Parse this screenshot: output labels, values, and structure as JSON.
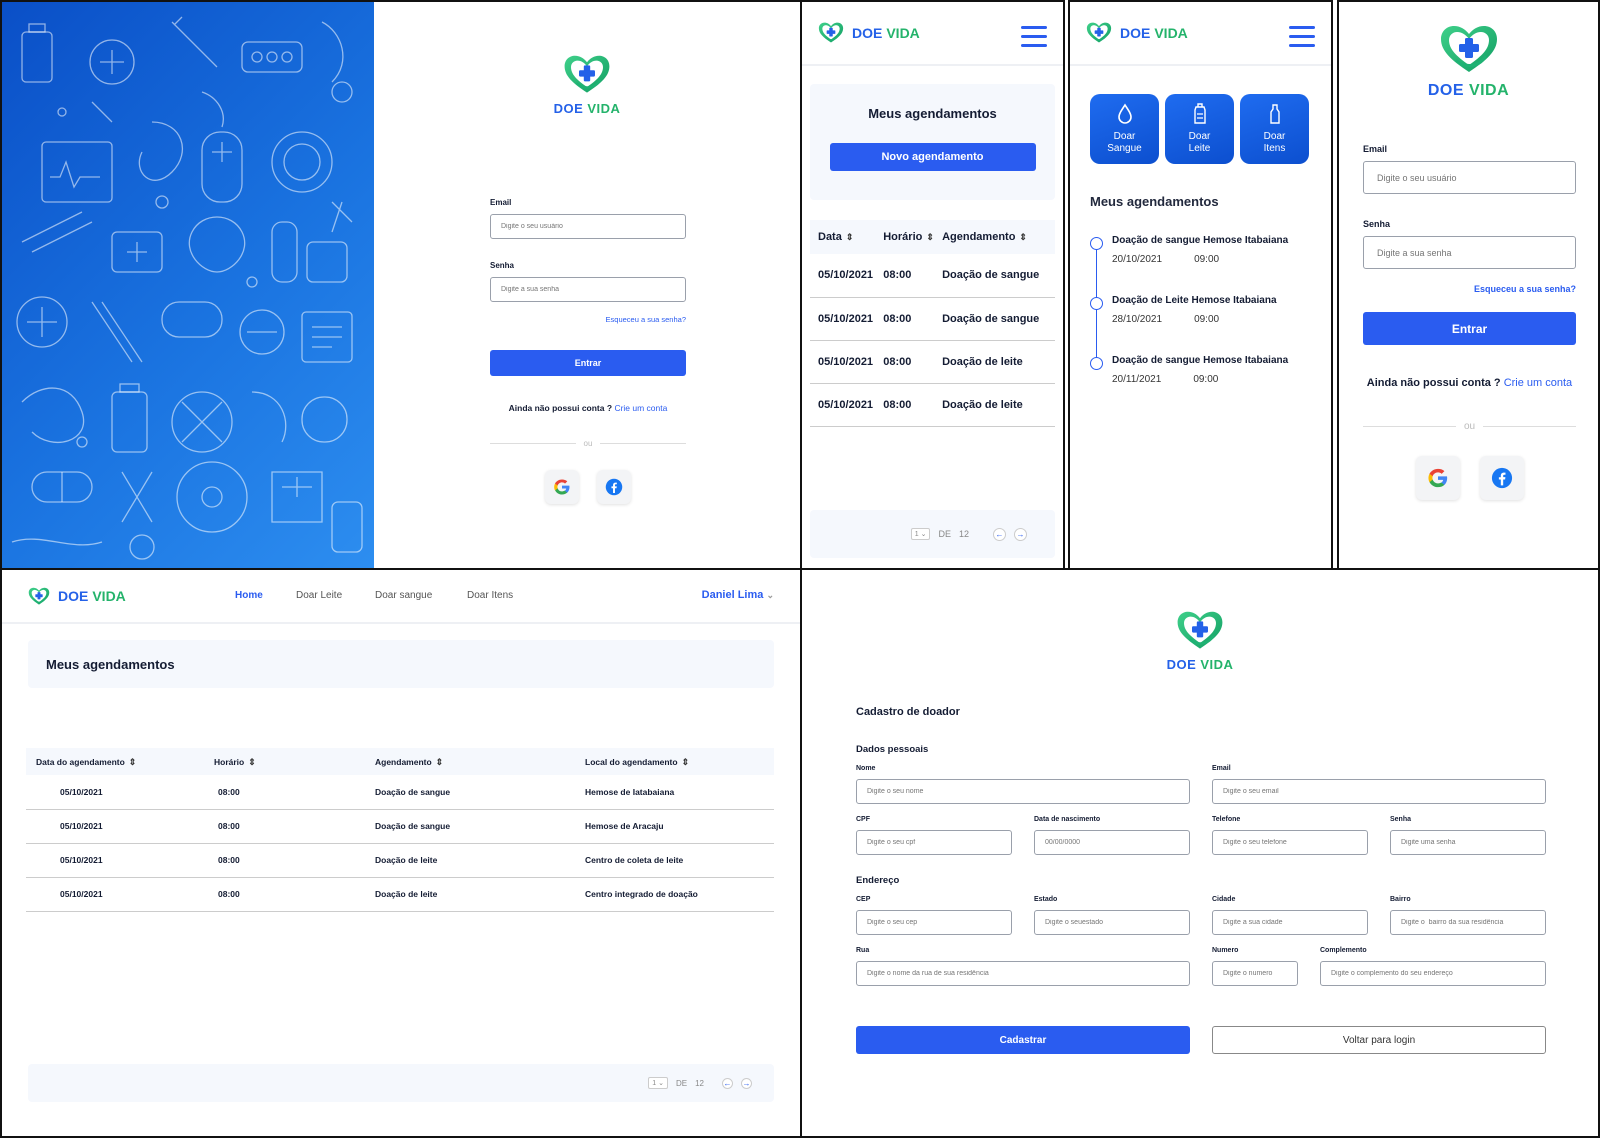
{
  "brand": {
    "doe": "DOE",
    "vida": "VIDA"
  },
  "colors": {
    "primary": "#2a5cf0",
    "brand_green": "#24b36b",
    "brand_blue": "#2461e8"
  },
  "login": {
    "email_label": "Email",
    "email_placeholder": "Digite o seu usuário",
    "password_label": "Senha",
    "password_placeholder": "Digite a sua senha",
    "forgot": "Esqueceu a sua senha?",
    "submit": "Entrar",
    "no_account": "Ainda não possui conta ?",
    "create": "Crie um conta",
    "or": "ou",
    "social": [
      "google-icon",
      "facebook-icon"
    ]
  },
  "mobile_list": {
    "title": "Meus agendamentos",
    "new_button": "Novo agendamento",
    "columns": [
      "Data",
      "Horário",
      "Agendamento"
    ],
    "rows": [
      {
        "date": "05/10/2021",
        "time": "08:00",
        "type": "Doação de sangue"
      },
      {
        "date": "05/10/2021",
        "time": "08:00",
        "type": "Doação de sangue"
      },
      {
        "date": "05/10/2021",
        "time": "08:00",
        "type": "Doação de leite"
      },
      {
        "date": "05/10/2021",
        "time": "08:00",
        "type": "Doação de leite"
      }
    ],
    "pager": {
      "page": "1",
      "of": "DE",
      "total": "12"
    }
  },
  "mobile_home": {
    "tiles": [
      {
        "line1": "Doar",
        "line2": "Sangue",
        "icon": "drop-icon"
      },
      {
        "line1": "Doar",
        "line2": "Leite",
        "icon": "baby-bottle-icon"
      },
      {
        "line1": "Doar",
        "line2": "Itens",
        "icon": "bottle-icon"
      }
    ],
    "section_title": "Meus agendamentos",
    "timeline": [
      {
        "title": "Doação de sangue Hemose Itabaiana",
        "date": "20/10/2021",
        "time": "09:00"
      },
      {
        "title": "Doação de Leite Hemose Itabaiana",
        "date": "28/10/2021",
        "time": "09:00"
      },
      {
        "title": "Doação de sangue Hemose Itabaiana",
        "date": "20/11/2021",
        "time": "09:00"
      }
    ]
  },
  "desktop": {
    "nav": [
      "Home",
      "Doar Leite",
      "Doar sangue",
      "Doar Itens"
    ],
    "user": "Daniel Lima",
    "title": "Meus agendamentos",
    "columns": [
      "Data do agendamento",
      "Horário",
      "Agendamento",
      "Local do agendamento"
    ],
    "rows": [
      {
        "date": "05/10/2021",
        "time": "08:00",
        "type": "Doação de sangue",
        "place": "Hemose de Iatabaiana"
      },
      {
        "date": "05/10/2021",
        "time": "08:00",
        "type": "Doação de sangue",
        "place": "Hemose de Aracaju"
      },
      {
        "date": "05/10/2021",
        "time": "08:00",
        "type": "Doação de leite",
        "place": "Centro de coleta de leite"
      },
      {
        "date": "05/10/2021",
        "time": "08:00",
        "type": "Doação de leite",
        "place": "Centro integrado de doação"
      }
    ],
    "pager": {
      "page": "1",
      "of": "DE",
      "total": "12"
    }
  },
  "register": {
    "title": "Cadastro de doador",
    "personal": "Dados pessoais",
    "address": "Endereço",
    "fields": {
      "nome": {
        "label": "Nome",
        "ph": "Digite o seu nome"
      },
      "email": {
        "label": "Email",
        "ph": "Digite o seu email"
      },
      "cpf": {
        "label": "CPF",
        "ph": "Digite o seu cpf"
      },
      "nasc": {
        "label": "Data de nascimento",
        "ph": "00/00/0000"
      },
      "tel": {
        "label": "Telefone",
        "ph": "Digite o seu telefone"
      },
      "senha": {
        "label": "Senha",
        "ph": "Digite uma senha"
      },
      "cep": {
        "label": "CEP",
        "ph": "Digite o seu cep"
      },
      "estado": {
        "label": "Estado",
        "ph": "Digite o seuestado"
      },
      "cidade": {
        "label": "Cidade",
        "ph": "Digite a sua cidade"
      },
      "bairro": {
        "label": "Bairro",
        "ph": "Digite o  bairro da sua residência"
      },
      "rua": {
        "label": "Rua",
        "ph": "Digite o nome da rua de sua residência"
      },
      "numero": {
        "label": "Numero",
        "ph": "Digite o numero"
      },
      "compl": {
        "label": "Complemento",
        "ph": "Digite o complemento do seu endereço"
      }
    },
    "submit": "Cadastrar",
    "back": "Voltar para login"
  }
}
